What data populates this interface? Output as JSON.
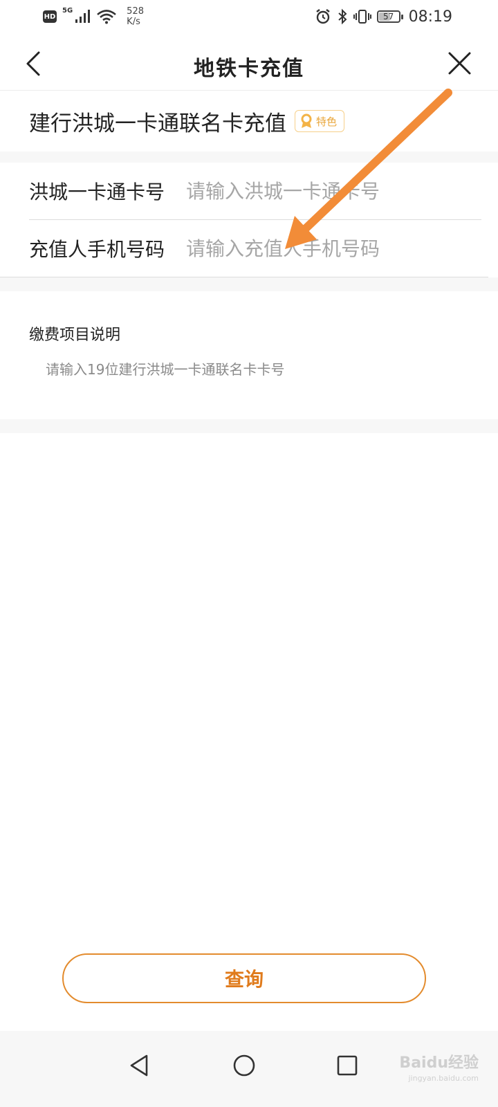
{
  "status_bar": {
    "hd": "HD",
    "network": "5G",
    "speed_value": "528",
    "speed_unit": "K/s",
    "battery_level": "57",
    "time": "08:19"
  },
  "header": {
    "title": "地铁卡充值"
  },
  "card": {
    "title": "建行洪城一卡通联名卡充值",
    "badge": "特色"
  },
  "form": {
    "card_number": {
      "label": "洪城一卡通卡号",
      "placeholder": "请输入洪城一卡通卡号",
      "value": ""
    },
    "phone": {
      "label": "充值人手机号码",
      "placeholder": "请输入充值人手机号码",
      "value": ""
    }
  },
  "notes": {
    "title": "缴费项目说明",
    "text": "请输入19位建行洪城一卡通联名卡卡号"
  },
  "actions": {
    "query_label": "查询"
  },
  "watermark": {
    "brand": "Baidu经验",
    "url": "jingyan.baidu.com"
  },
  "colors": {
    "accent": "#e07b1c",
    "arrow": "#f28c38",
    "badge": "#e9a63a"
  }
}
